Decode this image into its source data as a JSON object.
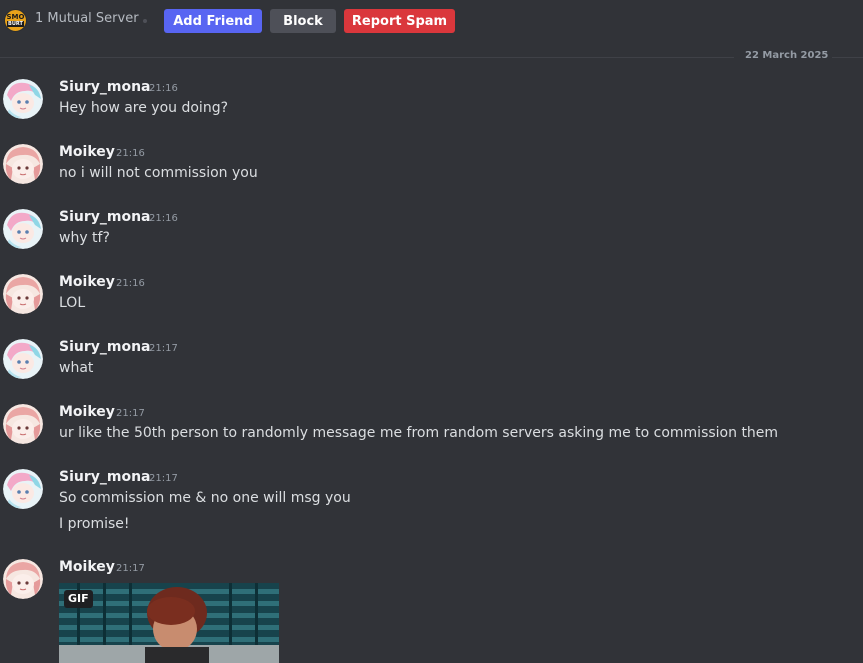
{
  "header": {
    "server_icon_line1": "SMO",
    "server_icon_line2": "BURT",
    "mutual_servers": "1 Mutual Server",
    "add_friend_label": "Add Friend",
    "block_label": "Block",
    "report_spam_label": "Report Spam"
  },
  "divider": {
    "date": "22 March 2025"
  },
  "messages": [
    {
      "author": "Siury_mona",
      "time": "21:16",
      "lines": [
        "Hey how are you doing?"
      ]
    },
    {
      "author": "Moikey",
      "time": "21:16",
      "lines": [
        "no i will not commission you"
      ]
    },
    {
      "author": "Siury_mona",
      "time": "21:16",
      "lines": [
        "why tf?"
      ]
    },
    {
      "author": "Moikey",
      "time": "21:16",
      "lines": [
        "LOL"
      ]
    },
    {
      "author": "Siury_mona",
      "time": "21:17",
      "lines": [
        "what"
      ]
    },
    {
      "author": "Moikey",
      "time": "21:17",
      "lines": [
        "ur like the 50th person to randomly message me from random servers asking me to commission them"
      ]
    },
    {
      "author": "Siury_mona",
      "time": "21:17",
      "lines": [
        "So commission me & no one will msg you",
        "I promise!"
      ]
    },
    {
      "author": "Moikey",
      "time": "21:17",
      "lines": []
    }
  ],
  "gif": {
    "badge": "GIF"
  },
  "colors": {
    "background": "#313338",
    "add_friend": "#5865f2",
    "block": "#4e5058",
    "report_spam": "#da373c",
    "username": "#f2f3f5",
    "timestamp": "#949ba4",
    "message_text": "#dbdee1"
  }
}
